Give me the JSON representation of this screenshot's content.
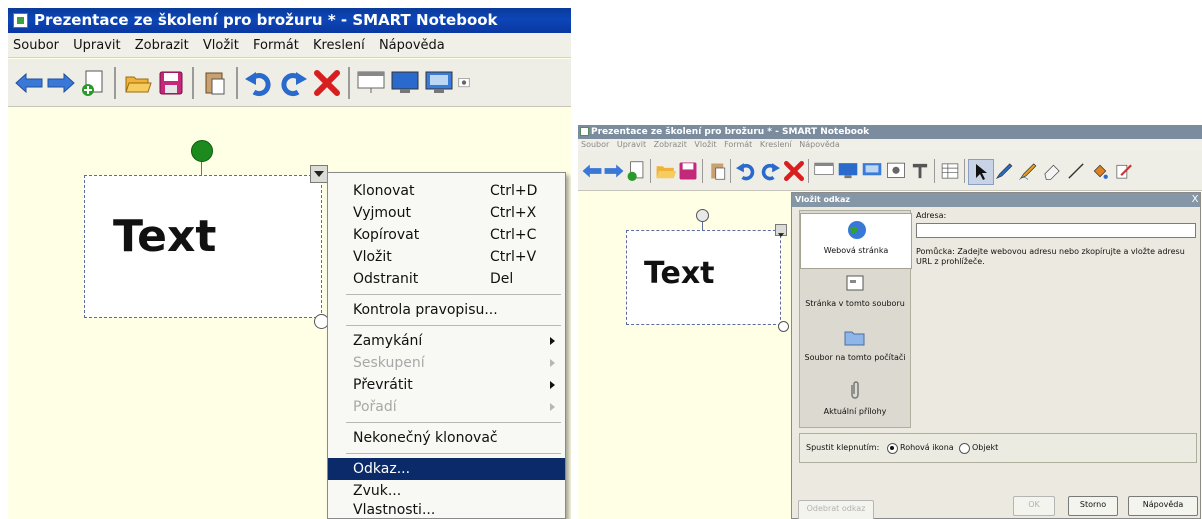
{
  "left": {
    "title": "Prezentace ze školení pro brožuru * - SMART Notebook",
    "menu": [
      "Soubor",
      "Upravit",
      "Zobrazit",
      "Vložit",
      "Formát",
      "Kreslení",
      "Nápověda"
    ],
    "canvas_text": "Text",
    "context_menu": [
      {
        "label": "Klonovat",
        "shortcut": "Ctrl+D"
      },
      {
        "label": "Vyjmout",
        "shortcut": "Ctrl+X"
      },
      {
        "label": "Kopírovat",
        "shortcut": "Ctrl+C"
      },
      {
        "label": "Vložit",
        "shortcut": "Ctrl+V"
      },
      {
        "label": "Odstranit",
        "shortcut": "Del"
      },
      {
        "label": "Kontrola pravopisu..."
      },
      {
        "label": "Zamykání",
        "submenu": true
      },
      {
        "label": "Seskupení",
        "submenu": true,
        "disabled": true
      },
      {
        "label": "Převrátit",
        "submenu": true
      },
      {
        "label": "Pořadí",
        "submenu": true,
        "disabled": true
      },
      {
        "label": "Nekonečný klonovač"
      },
      {
        "label": "Odkaz...",
        "selected": true
      },
      {
        "label": "Zvuk..."
      },
      {
        "label": "Vlastnosti..."
      }
    ]
  },
  "right": {
    "title": "Prezentace ze školení pro brožuru * - SMART Notebook",
    "menu": [
      "Soubor",
      "Upravit",
      "Zobrazit",
      "Vložit",
      "Formát",
      "Kreslení",
      "Nápověda"
    ],
    "canvas_text": "Text",
    "dialog": {
      "title": "Vložit odkaz",
      "close": "X",
      "side_items": [
        {
          "label": "Webová stránka",
          "icon": "globe-icon",
          "selected": true
        },
        {
          "label": "Stránka v tomto souboru",
          "icon": "page-icon"
        },
        {
          "label": "Soubor na tomto počítači",
          "icon": "folder-icon"
        },
        {
          "label": "Aktuální přílohy",
          "icon": "paperclip-icon"
        }
      ],
      "address_label": "Adresa:",
      "address_value": "",
      "hint": "Pomůcka: Zadejte webovou adresu nebo zkopírujte a vložte adresu URL z prohlížeče.",
      "run_label": "Spustit klepnutím:",
      "run_options": [
        {
          "label": "Rohová ikona",
          "checked": true
        },
        {
          "label": "Objekt",
          "checked": false
        }
      ],
      "remove_link": "Odebrat odkaz",
      "ok": "OK",
      "cancel": "Storno",
      "help": "Nápověda"
    }
  },
  "colors": {
    "title_bar": "#0c46b8",
    "canvas": "#ffffe6",
    "menu_selected": "#0a2a6a",
    "rotate_handle": "#1c8a1c"
  }
}
